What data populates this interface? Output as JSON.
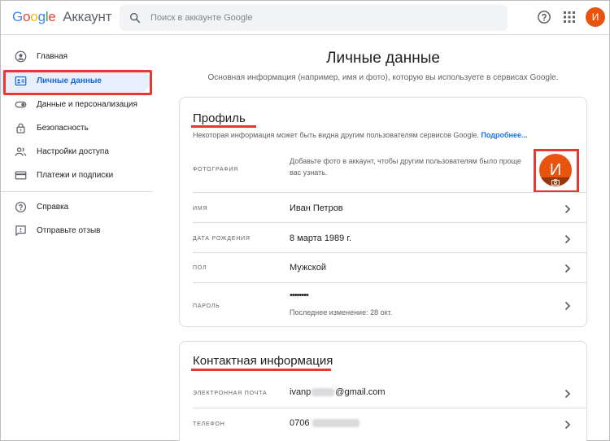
{
  "header": {
    "logo_g1": "G",
    "logo_o1": "o",
    "logo_o2": "o",
    "logo_g2": "g",
    "logo_l": "l",
    "logo_e": "e",
    "product": "Аккаунт",
    "search_placeholder": "Поиск в аккаунте Google",
    "avatar_letter": "И"
  },
  "sidebar": {
    "items": [
      {
        "label": "Главная",
        "icon": "account-circle-icon"
      },
      {
        "label": "Личные данные",
        "icon": "id-card-icon",
        "active": true
      },
      {
        "label": "Данные и персонализация",
        "icon": "toggle-icon"
      },
      {
        "label": "Безопасность",
        "icon": "lock-icon"
      },
      {
        "label": "Настройки доступа",
        "icon": "people-icon"
      },
      {
        "label": "Платежи и подписки",
        "icon": "credit-card-icon"
      },
      {
        "label": "Справка",
        "icon": "help-icon"
      },
      {
        "label": "Отправьте отзыв",
        "icon": "feedback-icon"
      }
    ]
  },
  "main": {
    "title": "Личные данные",
    "subtitle": "Основная информация (например, имя и фото), которую вы используете в сервисах Google."
  },
  "profile": {
    "title": "Профиль",
    "description": "Некоторая информация может быть видна другим пользователям сервисов Google.",
    "more_link": "Подробнее...",
    "photo_label": "Фотография",
    "photo_text": "Добавьте фото в аккаунт, чтобы другим пользователям было проще вас узнать.",
    "photo_letter": "И",
    "name_label": "Имя",
    "name_value": "Иван Петров",
    "birthday_label": "Дата рождения",
    "birthday_value": "8 марта 1989 г.",
    "gender_label": "Пол",
    "gender_value": "Мужской",
    "password_label": "Пароль",
    "password_value": "••••••••",
    "password_changed": "Последнее изменение: 28 окт."
  },
  "contact": {
    "title": "Контактная информация",
    "email_label": "Электронная почта",
    "email_prefix": "ivanp",
    "email_suffix": "@gmail.com",
    "phone_label": "Телефон",
    "phone_prefix": "0706"
  },
  "colors": {
    "accent": "#1967d2",
    "highlight": "#e53935",
    "avatar": "#e8530e"
  }
}
